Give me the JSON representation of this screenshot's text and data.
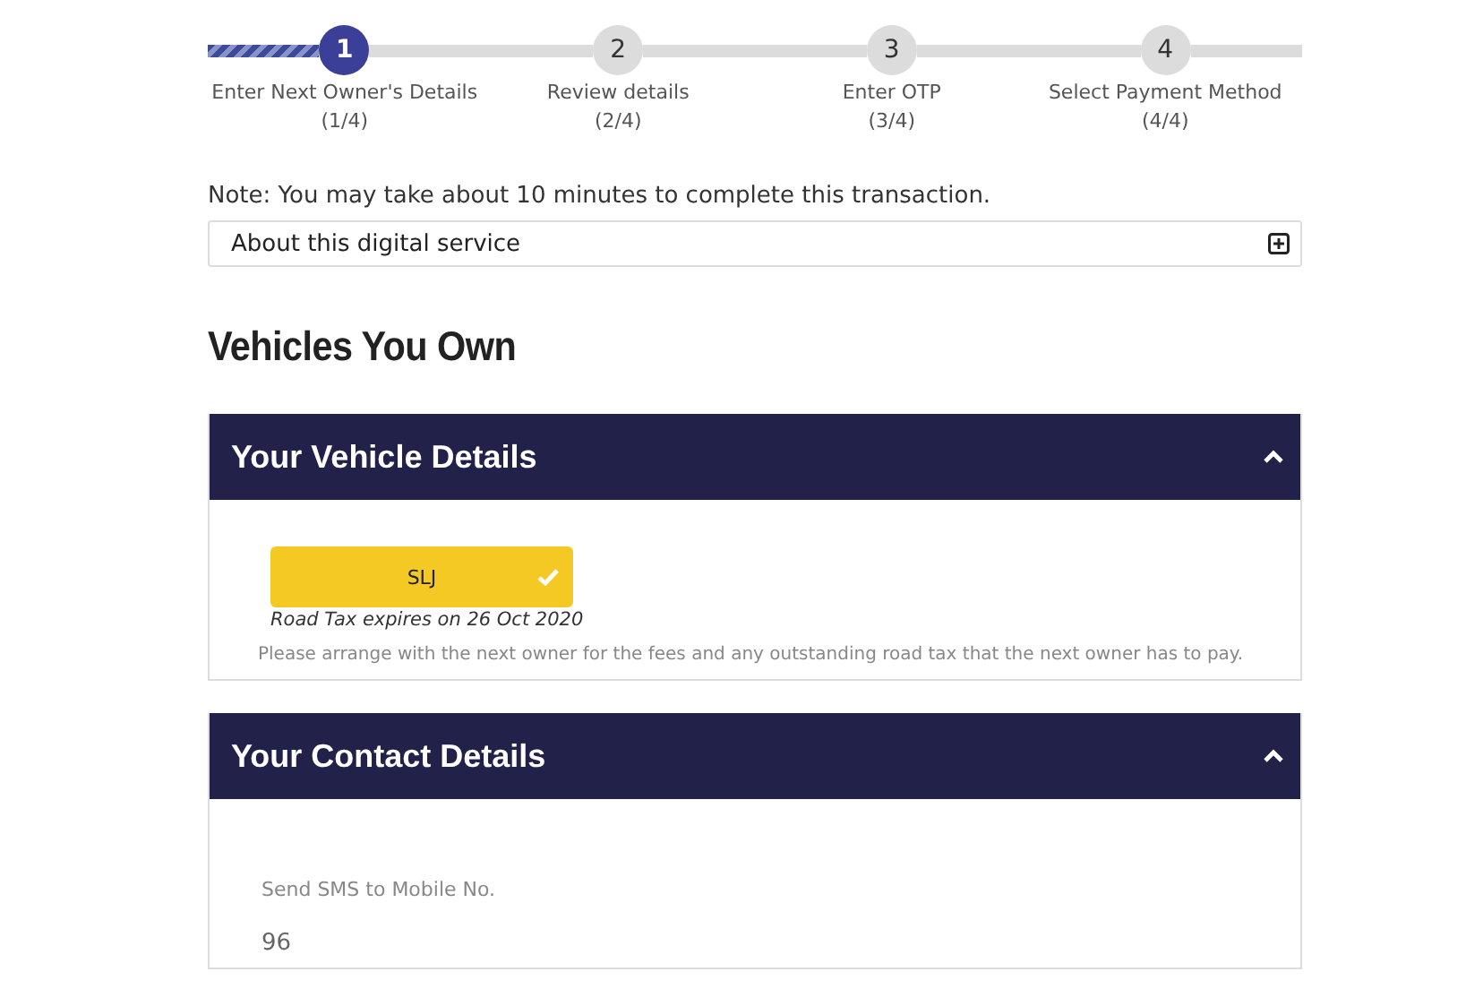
{
  "steps": [
    {
      "number": "1",
      "label": "Enter Next Owner's Details",
      "count": "(1/4)",
      "selected": true
    },
    {
      "number": "2",
      "label": "Review details",
      "count": "(2/4)",
      "selected": false
    },
    {
      "number": "3",
      "label": "Enter OTP",
      "count": "(3/4)",
      "selected": false
    },
    {
      "number": "4",
      "label": "Select Payment Method",
      "count": "(4/4)",
      "selected": false
    }
  ],
  "note": "Note: You may take about 10 minutes to complete this transaction.",
  "about": {
    "label": "About this digital service",
    "expanded": false
  },
  "heading": "Vehicles You Own",
  "panels": [
    {
      "kind": "vehicle",
      "title": "Your Vehicle Details",
      "expanded": true,
      "vehicles": [
        {
          "plate": "SLJ",
          "selected": true,
          "road_tax": "Road Tax expires on 26 Oct 2020"
        }
      ],
      "hint": "Please arrange with the next owner for the fees and any outstanding road tax that the next owner has to pay."
    },
    {
      "kind": "contact",
      "title": "Your Contact Details",
      "expanded": true,
      "field_label": "Send SMS to Mobile No.",
      "value": "96"
    }
  ]
}
